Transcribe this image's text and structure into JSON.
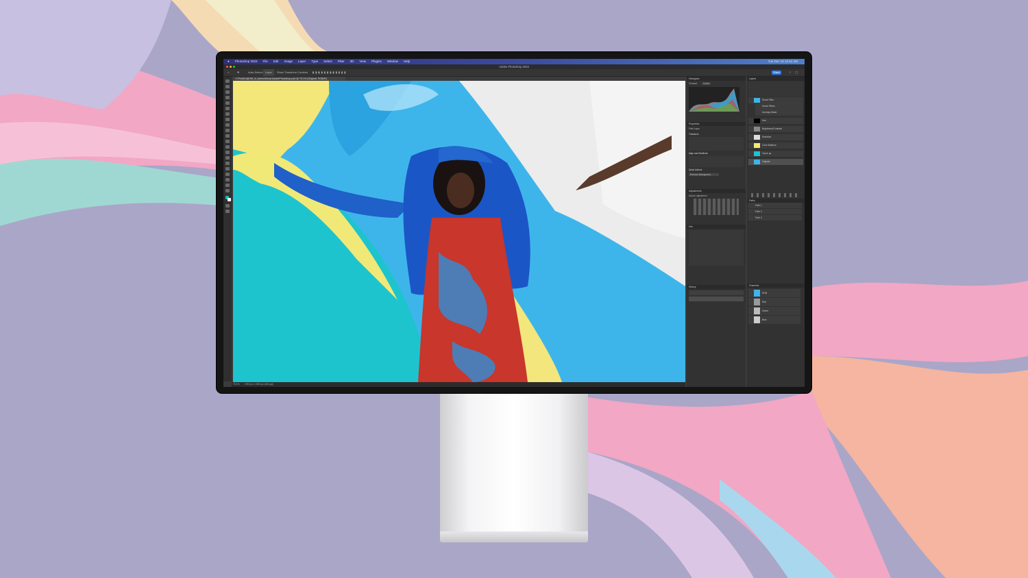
{
  "colors": {
    "background": "#aaa6c8",
    "accent_blue": "#2f7df3",
    "ps_panel": "#323232"
  },
  "menubar": {
    "items": [
      "Photoshop 2023",
      "File",
      "Edit",
      "Image",
      "Layer",
      "Type",
      "Select",
      "Filter",
      "3D",
      "View",
      "Plugins",
      "Window",
      "Help"
    ],
    "clock": "Tue Dec 13  12:41 AM"
  },
  "window": {
    "title": "Adobe Photoshop 2023"
  },
  "options_bar": {
    "auto_select_label": "Auto-Select:",
    "auto_select_value": "Layer",
    "show_transform": "Show Transform Controls",
    "share_label": "Share"
  },
  "document": {
    "tab_label": "C:ProfileJ@OM_in_stereo\\Mural-AdobePhotoshop.psd @ 75.1% (Original, RGB/8*)"
  },
  "status": {
    "zoom": "75.1%",
    "doc_info": "1753 px x 1050 px (150 ppi)"
  },
  "panels": {
    "histogram": "Histogram",
    "channel_label": "Channel:",
    "channel_value": "Colors",
    "properties": "Properties",
    "pixel_layer": "Pixel Layer",
    "transform": "Transform",
    "align": "Align and Distribute",
    "quick_actions": "Quick Actions",
    "remove_bg": "Remove Background",
    "adjustments": "Adjustments",
    "add_adjustment": "Add an adjustment",
    "info": "Info",
    "history": "History",
    "layers": "Layers",
    "layer_names": [
      "Smart Filter",
      "Smart Filters",
      "Unsharp Mask",
      "Hue",
      "Brightness/Contrast",
      "Selective",
      "Color Balance",
      "Touch up",
      "Original"
    ],
    "paths": "Paths",
    "path_names": [
      "Path 1",
      "Path 2",
      "Path 3"
    ],
    "channels": "Channels",
    "channel_names": [
      "RGB",
      "Red",
      "Green",
      "Blue"
    ]
  }
}
